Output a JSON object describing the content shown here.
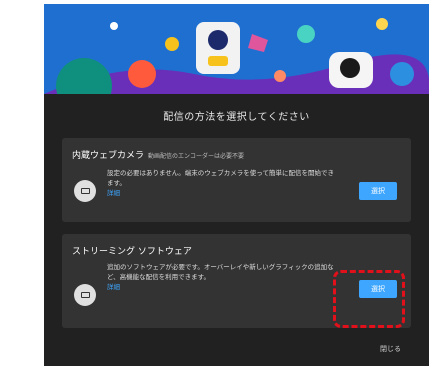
{
  "colors": {
    "dialog_bg": "#212121",
    "card_bg": "#333333",
    "accent": "#3ea6ff",
    "highlight": "#e2101a"
  },
  "dialog": {
    "heading": "配信の方法を選択してください",
    "close_label": "閉じる"
  },
  "options": [
    {
      "title": "内蔵ウェブカメラ",
      "subtitle": "動画配信のエンコーダーは必要不要",
      "description": "設定の必要はありません。端末のウェブカメラを使って簡単に配信を開始できます。",
      "link": "詳細",
      "button": "選択",
      "icon": "webcam-icon"
    },
    {
      "title": "ストリーミング ソフトウェア",
      "subtitle": "",
      "description": "追加のソフトウェアが必要です。オーバーレイや新しいグラフィックの追加など、高機能な配信を利用できます。",
      "link": "詳細",
      "button": "選択",
      "icon": "streaming-software-icon"
    }
  ]
}
